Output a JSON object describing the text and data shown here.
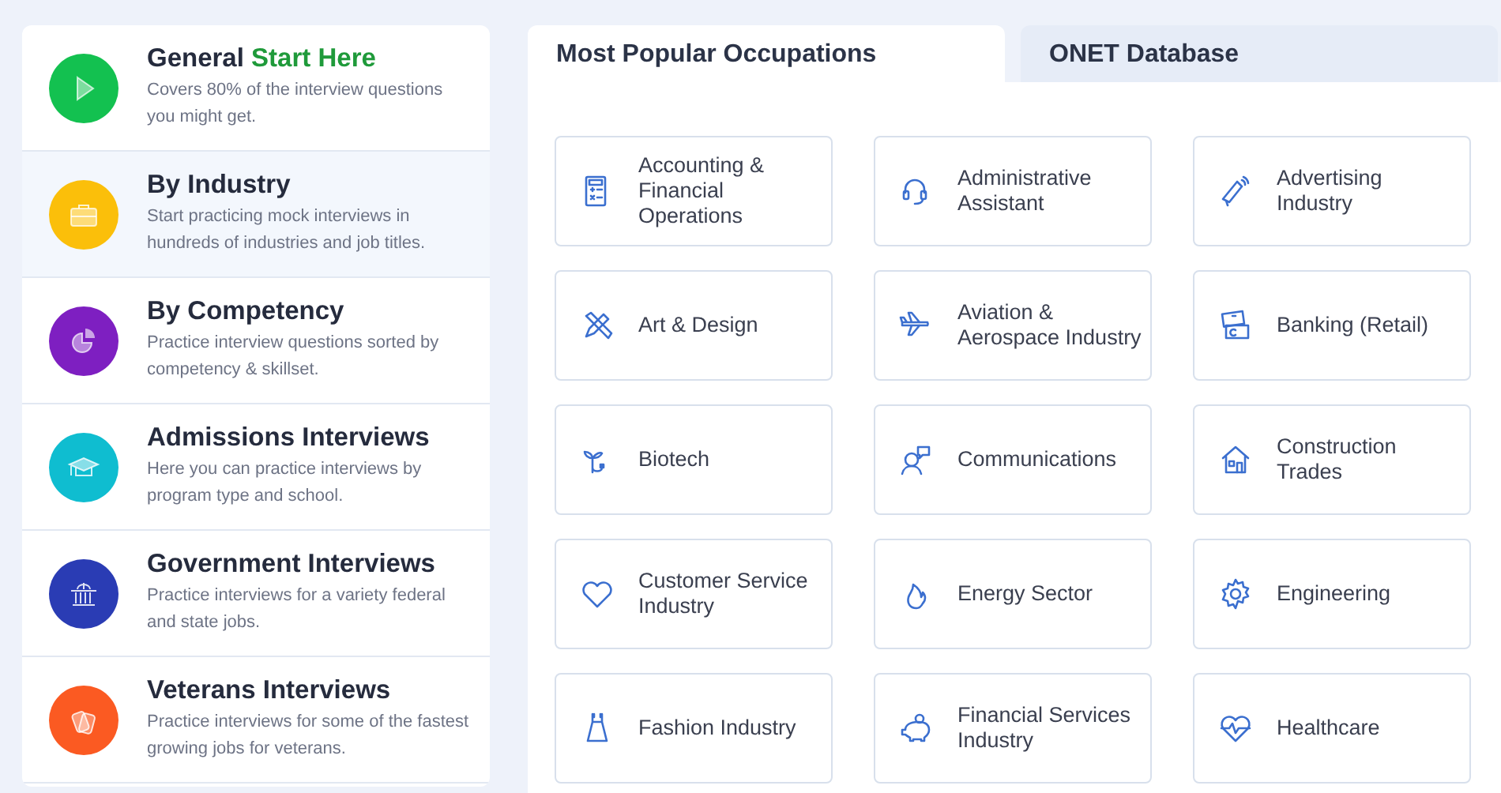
{
  "categories": [
    {
      "title": "General",
      "highlight": "Start Here",
      "description": "Covers 80% of the interview questions you might get.",
      "color": "#13c150",
      "selected": false
    },
    {
      "title": "By Industry",
      "description": "Start practicing mock interviews in hundreds of industries and job titles.",
      "color": "#fbbf0a",
      "selected": true
    },
    {
      "title": "By Competency",
      "description": "Practice interview questions sorted by competency & skillset.",
      "color": "#7e1fc1",
      "selected": false
    },
    {
      "title": "Admissions Interviews",
      "description": "Here you can practice interviews by program type and school.",
      "color": "#0fbdd0",
      "selected": false
    },
    {
      "title": "Government Interviews",
      "description": "Practice interviews for a variety federal and state jobs.",
      "color": "#2a3cb4",
      "selected": false
    },
    {
      "title": "Veterans Interviews",
      "description": "Practice interviews for some of the fastest growing jobs for veterans.",
      "color": "#fb5a22",
      "selected": false
    }
  ],
  "tabs": [
    {
      "label": "Most Popular Occupations",
      "selected": true
    },
    {
      "label": "ONET Database",
      "selected": false
    }
  ],
  "occupations": [
    "Accounting & Financial Operations",
    "Administrative Assistant",
    "Advertising Industry",
    "Art & Design",
    "Aviation & Aerospace Industry",
    "Banking (Retail)",
    "Biotech",
    "Communications",
    "Construction Trades",
    "Customer Service Industry",
    "Energy Sector",
    "Engineering",
    "Fashion Industry",
    "Financial Services Industry",
    "Healthcare"
  ]
}
